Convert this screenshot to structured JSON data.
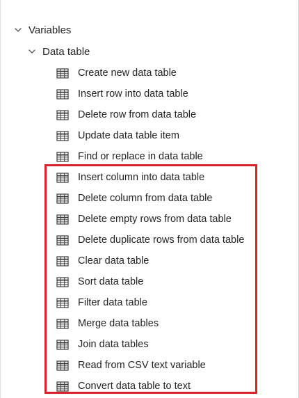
{
  "tree": {
    "group": {
      "label": "Variables",
      "icon": "chevron-down-icon"
    },
    "subgroup": {
      "label": "Data table",
      "icon": "chevron-down-icon"
    },
    "action_icon": "table-icon",
    "actions": [
      {
        "label": "Create new data table"
      },
      {
        "label": "Insert row into data table"
      },
      {
        "label": "Delete row from data table"
      },
      {
        "label": "Update data table item"
      },
      {
        "label": "Find or replace in data table"
      },
      {
        "label": "Insert column into data table"
      },
      {
        "label": "Delete column from data table"
      },
      {
        "label": "Delete empty rows from data table"
      },
      {
        "label": "Delete duplicate rows from data table"
      },
      {
        "label": "Clear data table"
      },
      {
        "label": "Sort data table"
      },
      {
        "label": "Filter data table"
      },
      {
        "label": "Merge data tables"
      },
      {
        "label": "Join data tables"
      },
      {
        "label": "Read from CSV text variable"
      },
      {
        "label": "Convert data table to text"
      }
    ]
  },
  "highlight": {
    "color": "#d9232a"
  }
}
